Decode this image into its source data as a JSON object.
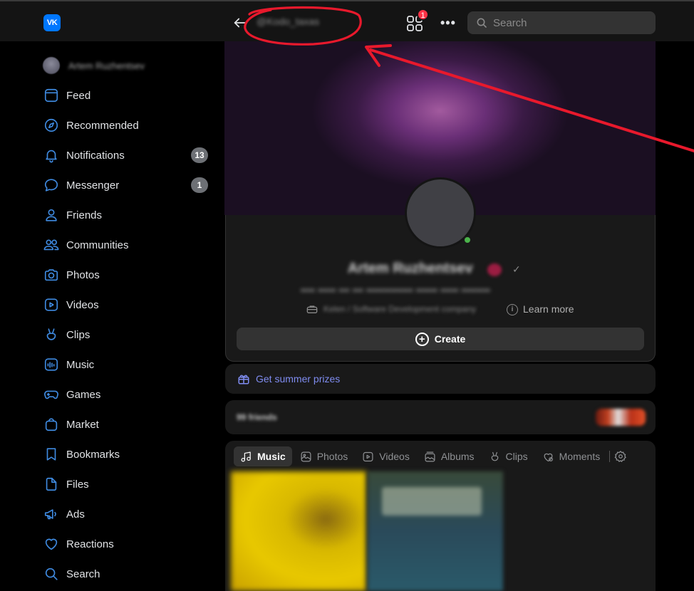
{
  "topbar": {
    "logo_text": "VK",
    "handle": "@Kodo_taxas",
    "apps_badge": "1",
    "more_label": "•••",
    "search_placeholder": "Search"
  },
  "sidebar": {
    "profile_name": "Artem Ruzhentsev",
    "items": [
      {
        "label": "Feed",
        "icon": "feed-icon"
      },
      {
        "label": "Recommended",
        "icon": "compass-icon"
      },
      {
        "label": "Notifications",
        "icon": "bell-icon",
        "badge": "13"
      },
      {
        "label": "Messenger",
        "icon": "chat-icon",
        "badge": "1"
      },
      {
        "label": "Friends",
        "icon": "user-icon"
      },
      {
        "label": "Communities",
        "icon": "users-icon"
      },
      {
        "label": "Photos",
        "icon": "camera-icon"
      },
      {
        "label": "Videos",
        "icon": "video-icon"
      },
      {
        "label": "Clips",
        "icon": "clips-icon"
      },
      {
        "label": "Music",
        "icon": "music-icon"
      },
      {
        "label": "Games",
        "icon": "gamepad-icon"
      },
      {
        "label": "Market",
        "icon": "bag-icon"
      },
      {
        "label": "Bookmarks",
        "icon": "bookmark-icon"
      },
      {
        "label": "Files",
        "icon": "file-icon"
      },
      {
        "label": "Ads",
        "icon": "megaphone-icon"
      },
      {
        "label": "Reactions",
        "icon": "heart-icon"
      },
      {
        "label": "Search",
        "icon": "search-icon"
      }
    ]
  },
  "profile": {
    "name": "Artem Ruzhentsev",
    "verified_mark": "✓",
    "status": "•••• ••••• ••• ••• ••••••••••••• •••••• ••••• ••••••••",
    "work": "Kelen / Software Development company",
    "learn_more": "Learn more",
    "info_glyph": "i",
    "create_label": "Create",
    "create_glyph": "+"
  },
  "prizes": {
    "label": "Get summer prizes"
  },
  "friends": {
    "label": "99 friends"
  },
  "media_tabs": [
    {
      "label": "Music",
      "active": true
    },
    {
      "label": "Photos",
      "active": false
    },
    {
      "label": "Videos",
      "active": false
    },
    {
      "label": "Albums",
      "active": false
    },
    {
      "label": "Clips",
      "active": false
    },
    {
      "label": "Moments",
      "active": false
    }
  ],
  "colors": {
    "accent": "#3f8ae0",
    "badge_red": "#ff3347",
    "online": "#4bb34b",
    "annotation": "#e8192c",
    "prize_link": "#7f8cf0"
  }
}
